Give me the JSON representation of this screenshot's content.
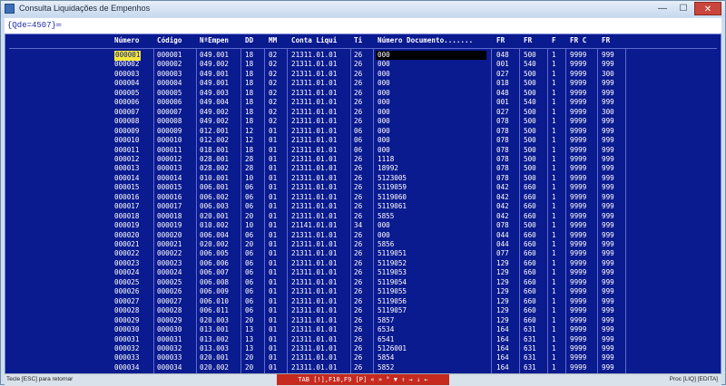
{
  "window": {
    "title": "Consulta Liquidações de Empenhos",
    "min": "—",
    "max": "☐",
    "close": "✕"
  },
  "console": {
    "qde": "{Qde=4507}═"
  },
  "headers": [
    "Número",
    "Código",
    "NºEmpen",
    "DD",
    "MM",
    "Conta Liqui",
    "Ti",
    "Número Documento.......",
    "FR",
    "FR",
    "F",
    "FR C",
    "FR"
  ],
  "rows": [
    [
      "000001",
      "000001",
      "049.001",
      "18",
      "02",
      "21311.01.01",
      "26",
      "000",
      "048",
      "500",
      "1",
      "9999",
      "999"
    ],
    [
      "000002",
      "000002",
      "049.002",
      "18",
      "02",
      "21311.01.01",
      "26",
      "000",
      "001",
      "540",
      "1",
      "9999",
      "999"
    ],
    [
      "000003",
      "000003",
      "049.001",
      "18",
      "02",
      "21311.01.01",
      "26",
      "000",
      "027",
      "500",
      "1",
      "9999",
      "300"
    ],
    [
      "000004",
      "000004",
      "049.001",
      "18",
      "02",
      "21311.01.01",
      "26",
      "000",
      "018",
      "500",
      "1",
      "9999",
      "999"
    ],
    [
      "000005",
      "000005",
      "049.003",
      "18",
      "02",
      "21311.01.01",
      "26",
      "000",
      "048",
      "500",
      "1",
      "9999",
      "999"
    ],
    [
      "000006",
      "000006",
      "049.004",
      "18",
      "02",
      "21311.01.01",
      "26",
      "000",
      "001",
      "540",
      "1",
      "9999",
      "999"
    ],
    [
      "000007",
      "000007",
      "049.002",
      "18",
      "02",
      "21311.01.01",
      "26",
      "000",
      "027",
      "500",
      "1",
      "9999",
      "300"
    ],
    [
      "000008",
      "000008",
      "049.002",
      "18",
      "02",
      "21311.01.01",
      "26",
      "000",
      "078",
      "500",
      "1",
      "9999",
      "999"
    ],
    [
      "000009",
      "000009",
      "012.001",
      "12",
      "01",
      "21311.01.01",
      "06",
      "000",
      "078",
      "500",
      "1",
      "9999",
      "999"
    ],
    [
      "000010",
      "000010",
      "012.002",
      "12",
      "01",
      "21311.01.01",
      "06",
      "000",
      "078",
      "500",
      "1",
      "9999",
      "999"
    ],
    [
      "000011",
      "000011",
      "018.001",
      "18",
      "01",
      "21311.01.01",
      "06",
      "000",
      "078",
      "500",
      "1",
      "9999",
      "999"
    ],
    [
      "000012",
      "000012",
      "028.001",
      "28",
      "01",
      "21311.01.01",
      "26",
      "1118",
      "078",
      "500",
      "1",
      "9999",
      "999"
    ],
    [
      "000013",
      "000013",
      "028.002",
      "28",
      "01",
      "21311.01.01",
      "26",
      "18992",
      "078",
      "500",
      "1",
      "9999",
      "999"
    ],
    [
      "000014",
      "000014",
      "010.001",
      "10",
      "01",
      "21311.01.01",
      "26",
      "5123005",
      "078",
      "500",
      "1",
      "9999",
      "999"
    ],
    [
      "000015",
      "000015",
      "006.001",
      "06",
      "01",
      "21311.01.01",
      "26",
      "5119059",
      "042",
      "660",
      "1",
      "9999",
      "999"
    ],
    [
      "000016",
      "000016",
      "006.002",
      "06",
      "01",
      "21311.01.01",
      "26",
      "5119060",
      "042",
      "660",
      "1",
      "9999",
      "999"
    ],
    [
      "000017",
      "000017",
      "006.003",
      "06",
      "01",
      "21311.01.01",
      "26",
      "5119061",
      "042",
      "660",
      "1",
      "9999",
      "999"
    ],
    [
      "000018",
      "000018",
      "020.001",
      "20",
      "01",
      "21311.01.01",
      "26",
      "5855",
      "042",
      "660",
      "1",
      "9999",
      "999"
    ],
    [
      "000019",
      "000019",
      "010.002",
      "10",
      "01",
      "21141.01.01",
      "34",
      "000",
      "078",
      "500",
      "1",
      "9999",
      "999"
    ],
    [
      "000020",
      "000020",
      "006.004",
      "06",
      "01",
      "21311.01.01",
      "26",
      "000",
      "044",
      "660",
      "1",
      "9999",
      "999"
    ],
    [
      "000021",
      "000021",
      "020.002",
      "20",
      "01",
      "21311.01.01",
      "26",
      "5856",
      "044",
      "660",
      "1",
      "9999",
      "999"
    ],
    [
      "000022",
      "000022",
      "006.005",
      "06",
      "01",
      "21311.01.01",
      "26",
      "5119051",
      "077",
      "660",
      "1",
      "9999",
      "999"
    ],
    [
      "000023",
      "000023",
      "006.006",
      "06",
      "01",
      "21311.01.01",
      "26",
      "5119052",
      "129",
      "660",
      "1",
      "9999",
      "999"
    ],
    [
      "000024",
      "000024",
      "006.007",
      "06",
      "01",
      "21311.01.01",
      "26",
      "5119053",
      "129",
      "660",
      "1",
      "9999",
      "999"
    ],
    [
      "000025",
      "000025",
      "006.008",
      "06",
      "01",
      "21311.01.01",
      "26",
      "5119054",
      "129",
      "660",
      "1",
      "9999",
      "999"
    ],
    [
      "000026",
      "000026",
      "006.009",
      "06",
      "01",
      "21311.01.01",
      "26",
      "5119055",
      "129",
      "660",
      "1",
      "9999",
      "999"
    ],
    [
      "000027",
      "000027",
      "006.010",
      "06",
      "01",
      "21311.01.01",
      "26",
      "5119056",
      "129",
      "660",
      "1",
      "9999",
      "999"
    ],
    [
      "000028",
      "000028",
      "006.011",
      "06",
      "01",
      "21311.01.01",
      "26",
      "5119057",
      "129",
      "660",
      "1",
      "9999",
      "999"
    ],
    [
      "000029",
      "000029",
      "020.003",
      "20",
      "01",
      "21311.01.01",
      "26",
      "5857",
      "129",
      "660",
      "1",
      "9999",
      "999"
    ],
    [
      "000030",
      "000030",
      "013.001",
      "13",
      "01",
      "21311.01.01",
      "26",
      "6534",
      "164",
      "631",
      "1",
      "9999",
      "999"
    ],
    [
      "000031",
      "000031",
      "013.002",
      "13",
      "01",
      "21311.01.01",
      "26",
      "6541",
      "164",
      "631",
      "1",
      "9999",
      "999"
    ],
    [
      "000032",
      "000032",
      "013.003",
      "13",
      "01",
      "21311.01.01",
      "26",
      "5126001",
      "164",
      "631",
      "1",
      "9999",
      "999"
    ],
    [
      "000033",
      "000033",
      "020.001",
      "20",
      "01",
      "21311.01.01",
      "26",
      "5854",
      "164",
      "631",
      "1",
      "9999",
      "999"
    ],
    [
      "000034",
      "000034",
      "020.002",
      "20",
      "01",
      "21311.01.01",
      "26",
      "5852",
      "164",
      "631",
      "1",
      "9999",
      "999"
    ]
  ],
  "status": {
    "left": "Tecle [ESC] para retornar",
    "mid": "TAB [!],F10,F9 [P] « » ° ▼ ↑ → ↓ ←",
    "right": "Proc [LIQ] [EDITA]"
  }
}
